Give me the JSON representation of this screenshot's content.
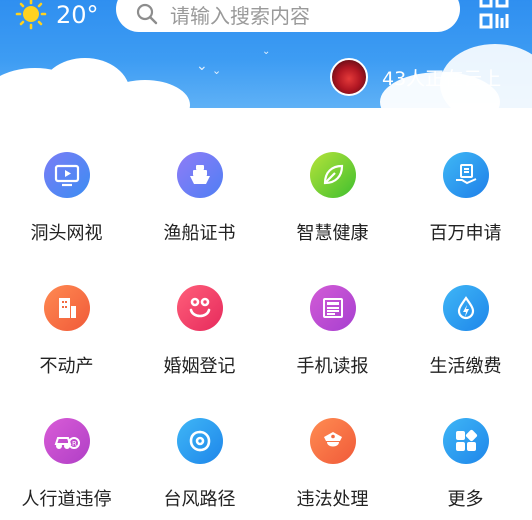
{
  "header": {
    "weather": {
      "temperature": "20°",
      "icon": "sun-icon"
    },
    "search": {
      "placeholder": "请输入搜索内容",
      "icon": "search-icon"
    },
    "qr_icon": "qr-code-icon",
    "online": {
      "text": "43人正在云上",
      "avatar_icon": "avatar"
    }
  },
  "grid": {
    "items": [
      {
        "label": "洞头网视",
        "icon": "tv-icon",
        "color_from": "#7a7cf6",
        "color_to": "#3b8df2"
      },
      {
        "label": "渔船证书",
        "icon": "ship-icon",
        "color_from": "#8f7cf7",
        "color_to": "#4f7ff4"
      },
      {
        "label": "智慧健康",
        "icon": "leaf-icon",
        "color_from": "#b6e33a",
        "color_to": "#3fbf2f"
      },
      {
        "label": "百万申请",
        "icon": "hand-document-icon",
        "color_from": "#3fb8f5",
        "color_to": "#1f7fe9"
      },
      {
        "label": "不动产",
        "icon": "building-icon",
        "color_from": "#ff8a52",
        "color_to": "#f05a39"
      },
      {
        "label": "婚姻登记",
        "icon": "couple-icon",
        "color_from": "#ff5f7a",
        "color_to": "#e62a5c"
      },
      {
        "label": "手机读报",
        "icon": "newspaper-icon",
        "color_from": "#d25bd6",
        "color_to": "#a73fd0"
      },
      {
        "label": "生活缴费",
        "icon": "water-drop-icon",
        "color_from": "#3fb6f6",
        "color_to": "#1e86ea"
      },
      {
        "label": "人行道违停",
        "icon": "parking-car-icon",
        "color_from": "#d95cd7",
        "color_to": "#b03fc6"
      },
      {
        "label": "台风路径",
        "icon": "typhoon-icon",
        "color_from": "#3fb6f6",
        "color_to": "#1e86ea"
      },
      {
        "label": "违法处理",
        "icon": "police-icon",
        "color_from": "#ff8c52",
        "color_to": "#f05a39"
      },
      {
        "label": "更多",
        "icon": "more-grid-icon",
        "color_from": "#3fb6f6",
        "color_to": "#1e86ea"
      }
    ]
  }
}
